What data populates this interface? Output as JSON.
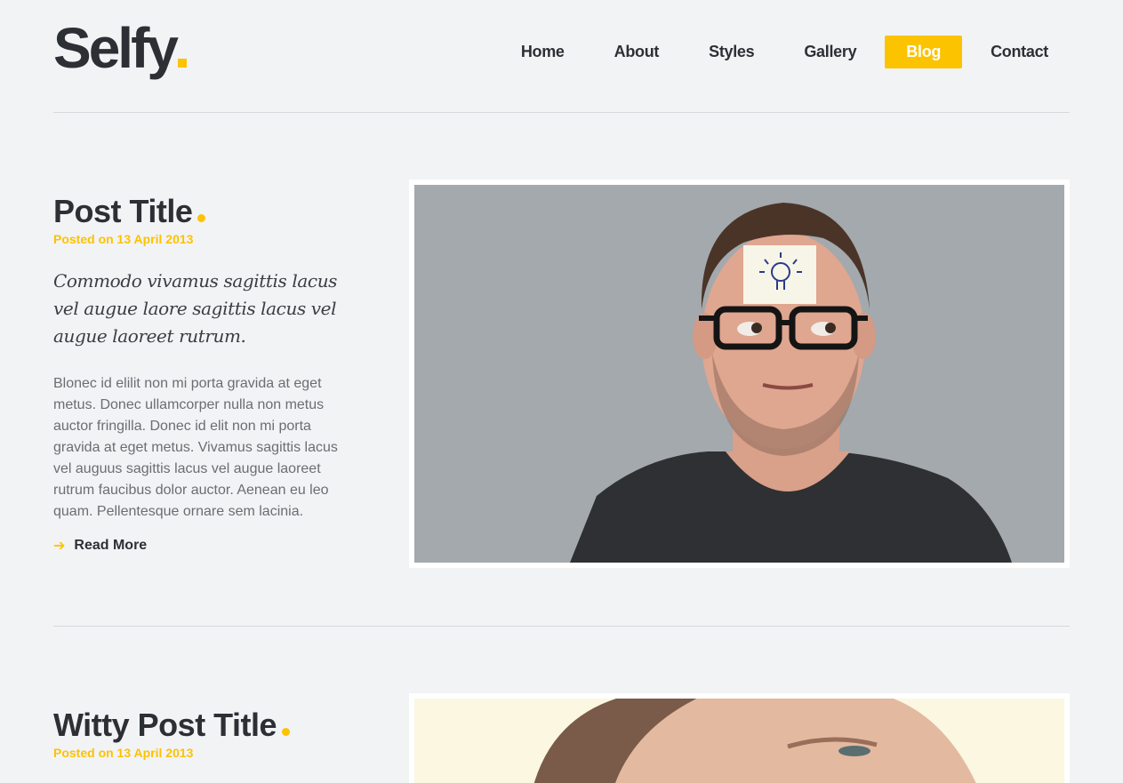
{
  "brand": {
    "name": "Selfy",
    "accent": "#fcc300"
  },
  "nav": {
    "items": [
      {
        "label": "Home"
      },
      {
        "label": "About"
      },
      {
        "label": "Styles"
      },
      {
        "label": "Gallery"
      },
      {
        "label": "Blog"
      },
      {
        "label": "Contact"
      }
    ],
    "active": "Blog"
  },
  "posts": [
    {
      "title": "Post Title",
      "date": "Posted on 13 April 2013",
      "lead": "Commodo vivamus sagittis lacus vel augue laore sagittis lacus vel augue laoreet rutrum.",
      "body": "Blonec id elilit non mi porta gravida at eget metus. Donec ullamcorper nulla non metus auctor fringilla. Donec id elit non mi porta gravida at eget metus. Vivamus sagittis lacus vel auguus sagittis lacus vel augue laoreet rutrum faucibus dolor auctor. Aenean eu leo quam. Pellentesque ornare sem lacinia.",
      "read_more": "Read More",
      "image_icon": "man-with-lightbulb-note-photo"
    },
    {
      "title": "Witty Post Title",
      "date": "Posted on 13 April 2013",
      "image_icon": "man-squinting-photo"
    }
  ]
}
